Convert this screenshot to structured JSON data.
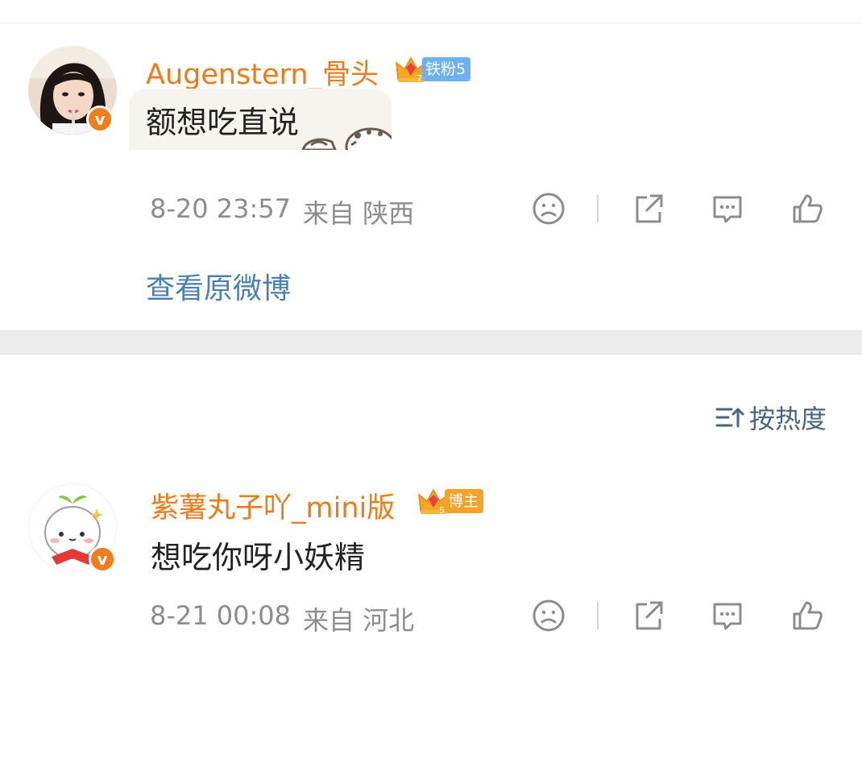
{
  "comments": [
    {
      "username": "Augenstern_骨头",
      "crown_level": "7",
      "badge": "铁粉5",
      "badge_color": "#6fb0ee",
      "verified_mark": "v",
      "text": "额想吃直说",
      "has_sticker": true,
      "time": "8-20 23:57",
      "source": "来自 陕西",
      "view_original": "查看原微博"
    },
    {
      "username": "紫薯丸子吖_mini版",
      "crown_level": "5",
      "badge": "博主",
      "badge_color": "#f6a226",
      "verified_mark": "v",
      "text": "想吃你呀小妖精",
      "time": "8-21 00:08",
      "source": "来自 河北"
    }
  ],
  "sort": {
    "label": "按热度",
    "icon": "sort-icon"
  },
  "actions": [
    "dislike-icon",
    "share-icon",
    "comment-icon",
    "like-icon"
  ],
  "colors": {
    "username": "#ef7a18",
    "link": "#4a7fb3",
    "meta": "#8c8c8c",
    "verified": "#f27b1a"
  }
}
